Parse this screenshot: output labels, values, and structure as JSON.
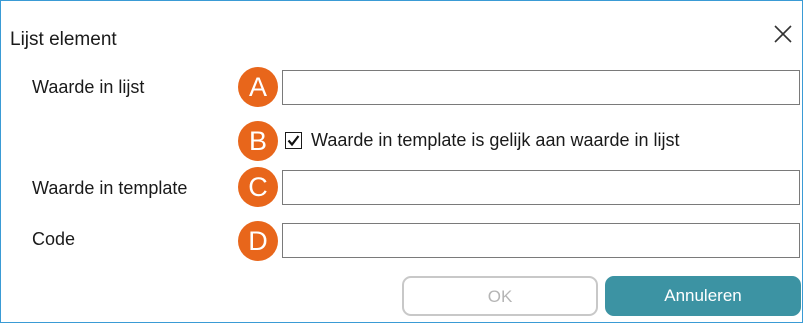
{
  "window": {
    "title": "Lijst element",
    "close_icon": "close-icon",
    "border_color": "#3a9bd5"
  },
  "form": {
    "fields": [
      {
        "label": "Waarde in lijst",
        "marker": "A",
        "value": ""
      },
      {
        "label": "Waarde in template",
        "marker": "C",
        "value": ""
      },
      {
        "label": "Code",
        "marker": "D",
        "value": ""
      }
    ],
    "checkbox": {
      "marker": "B",
      "label": "Waarde in template is gelijk aan waarde in lijst",
      "checked": true
    }
  },
  "buttons": {
    "ok_label": "OK",
    "ok_enabled": false,
    "cancel_label": "Annuleren"
  },
  "colors": {
    "marker": "#e8661b",
    "primary_button": "#3c93a3",
    "disabled_text": "#b5b5b5"
  }
}
